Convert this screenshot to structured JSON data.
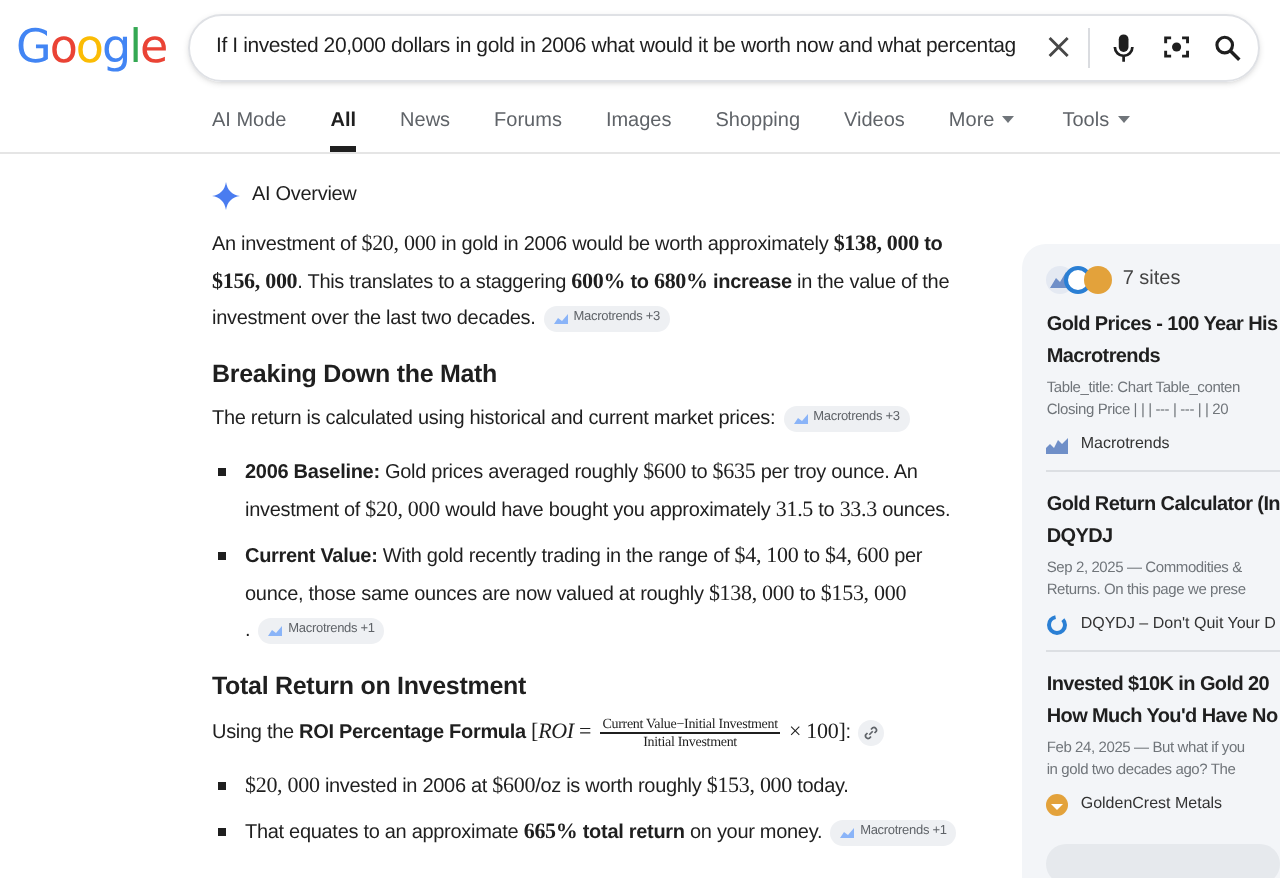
{
  "logo": "Google",
  "search": {
    "value": "If I invested 20,000 dollars in gold in 2006 what would it be worth now and what percentag"
  },
  "tabs": [
    {
      "label": "AI Mode",
      "selected": false,
      "kind": "tab"
    },
    {
      "label": "All",
      "selected": true,
      "kind": "tab"
    },
    {
      "label": "News",
      "selected": false,
      "kind": "tab"
    },
    {
      "label": "Forums",
      "selected": false,
      "kind": "tab"
    },
    {
      "label": "Images",
      "selected": false,
      "kind": "tab"
    },
    {
      "label": "Shopping",
      "selected": false,
      "kind": "tab"
    },
    {
      "label": "Videos",
      "selected": false,
      "kind": "tab"
    },
    {
      "label": "More",
      "selected": false,
      "kind": "menu"
    }
  ],
  "tools": {
    "label": "Tools"
  },
  "overview_label": "AI Overview",
  "blocks": [
    {
      "kind": "paragraph",
      "runs": [
        {
          "kind": "t",
          "text": "An investment of "
        },
        {
          "kind": "m",
          "text": "$20, 000"
        },
        {
          "kind": "t",
          "text": " in gold in 2006 would be worth approximately "
        },
        {
          "kind": "mb",
          "text": "$138, 000"
        },
        {
          "kind": "b",
          "text": " to "
        },
        {
          "kind": "mb",
          "text": "$156, 000"
        },
        {
          "kind": "t",
          "text": ". This translates to a staggering "
        },
        {
          "kind": "mb",
          "text": "600%"
        },
        {
          "kind": "b",
          "text": " to "
        },
        {
          "kind": "mb",
          "text": "680%"
        },
        {
          "kind": "b",
          "text": " increase"
        },
        {
          "kind": "t",
          "text": " in the value of the investment over the last two decades."
        }
      ],
      "chip": {
        "kind": "source",
        "label": "Macrotrends +3"
      }
    },
    {
      "kind": "heading",
      "text": "Breaking Down the Math"
    },
    {
      "kind": "paragraph",
      "runs": [
        {
          "kind": "t",
          "text": "The return is calculated using historical and current market prices:"
        }
      ],
      "chip": {
        "kind": "source",
        "label": "Macrotrends +3"
      }
    },
    {
      "kind": "bullets",
      "items": [
        {
          "runs": [
            {
              "kind": "b",
              "text": "2006 Baseline:"
            },
            {
              "kind": "t",
              "text": " Gold prices averaged roughly "
            },
            {
              "kind": "m",
              "text": "$600"
            },
            {
              "kind": "t",
              "text": " to "
            },
            {
              "kind": "m",
              "text": "$635"
            },
            {
              "kind": "t",
              "text": " per troy ounce. An investment of "
            },
            {
              "kind": "m",
              "text": "$20, 000"
            },
            {
              "kind": "t",
              "text": " would have bought you approximately "
            },
            {
              "kind": "m",
              "text": "31.5"
            },
            {
              "kind": "t",
              "text": " to "
            },
            {
              "kind": "m",
              "text": "33.3"
            },
            {
              "kind": "t",
              "text": " ounces."
            }
          ]
        },
        {
          "runs": [
            {
              "kind": "b",
              "text": "Current Value:"
            },
            {
              "kind": "t",
              "text": " With gold recently trading in the range of "
            },
            {
              "kind": "m",
              "text": "$4, 100"
            },
            {
              "kind": "t",
              "text": " to "
            },
            {
              "kind": "m",
              "text": "$4, 600"
            },
            {
              "kind": "t",
              "text": " per ounce, those same ounces are now valued at roughly "
            },
            {
              "kind": "m",
              "text": "$138, 000"
            },
            {
              "kind": "t",
              "text": " to "
            },
            {
              "kind": "m",
              "text": "$153, 000"
            },
            {
              "kind": "br"
            },
            {
              "kind": "t",
              "text": "."
            }
          ],
          "chip": {
            "kind": "source",
            "label": "Macrotrends +1"
          }
        }
      ]
    },
    {
      "kind": "heading",
      "text": "Total Return on Investment"
    },
    {
      "kind": "paragraph",
      "runs": [
        {
          "kind": "t",
          "text": "Using the "
        },
        {
          "kind": "b",
          "text": "ROI Percentage Formula"
        },
        {
          "kind": "m",
          "text": " ["
        },
        {
          "kind": "mi",
          "text": "ROI"
        },
        {
          "kind": "m",
          "text": " = "
        },
        {
          "kind": "fraction",
          "numerator": "Current Value−Initial Investment",
          "denominator": "Initial Investment"
        },
        {
          "kind": "m",
          "text": " × 100]"
        },
        {
          "kind": "t",
          "text": ":"
        }
      ],
      "chip": {
        "kind": "link"
      }
    },
    {
      "kind": "bullets",
      "items": [
        {
          "runs": [
            {
              "kind": "m",
              "text": "$20, 000"
            },
            {
              "kind": "t",
              "text": " invested in 2006 at "
            },
            {
              "kind": "m",
              "text": "$600"
            },
            {
              "kind": "t",
              "text": "/oz is worth roughly "
            },
            {
              "kind": "m",
              "text": "$153, 000"
            },
            {
              "kind": "t",
              "text": " today."
            }
          ]
        },
        {
          "runs": [
            {
              "kind": "t",
              "text": "That equates to an approximate "
            },
            {
              "kind": "mb",
              "text": "665%"
            },
            {
              "kind": "b",
              "text": " total return"
            },
            {
              "kind": "t",
              "text": " on your money."
            }
          ],
          "chip": {
            "kind": "source",
            "label": "Macrotrends +1"
          }
        }
      ]
    }
  ],
  "sources": {
    "count": "7 sites",
    "items": [
      {
        "title_lines": [
          "Gold Prices - 100 Year His",
          "Macrotrends"
        ],
        "snippet_lines": [
          "Table_title: Chart Table_conten",
          "Closing Price | | | --- | --- | | 20"
        ],
        "site": "Macrotrends"
      },
      {
        "title_lines": [
          "Gold Return Calculator (In",
          "DQYDJ"
        ],
        "snippet_lines": [
          "Sep 2, 2025 — Commodities &",
          "Returns. On this page we prese"
        ],
        "site": "DQYDJ – Don't Quit Your D"
      },
      {
        "title_lines": [
          "Invested $10K in Gold 20",
          "How Much You'd Have No"
        ],
        "snippet_lines": [
          "Feb 24, 2025 — But what if you",
          "in gold two decades ago? The"
        ],
        "site": "GoldenCrest Metals"
      }
    ]
  }
}
